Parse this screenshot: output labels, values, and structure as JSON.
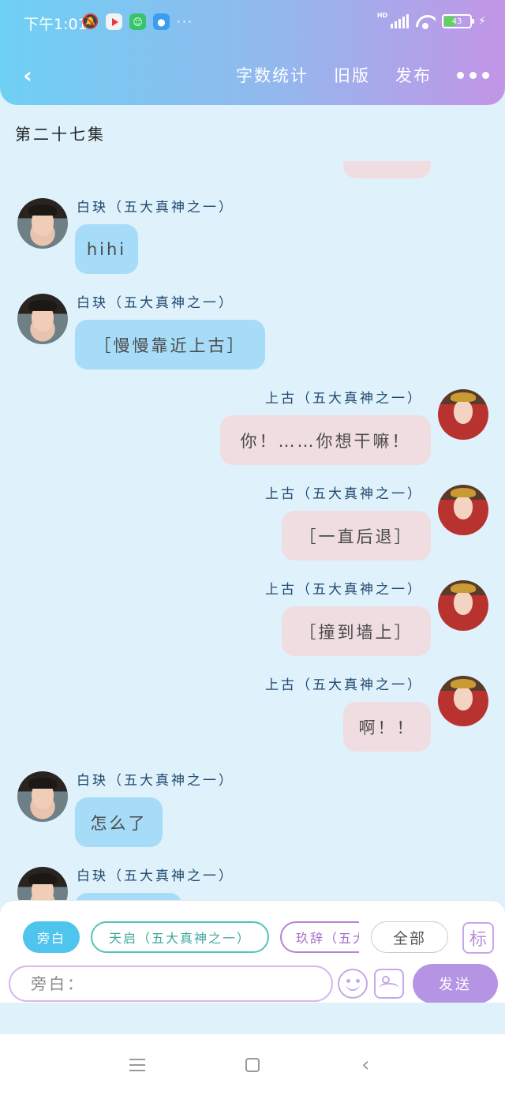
{
  "status_bar": {
    "time": "下午1:01",
    "more": "···",
    "hd": "HD",
    "battery": "43",
    "bolt": "⚡"
  },
  "nav": {
    "back_icon": "‹",
    "word_count": "字数统计",
    "old_version": "旧版",
    "publish": "发布"
  },
  "episode_title": "第二十七集",
  "messages": [
    {
      "side": "left",
      "avatar": "male",
      "sender": "白玦（五大真神之一）",
      "text": "hihi"
    },
    {
      "side": "left",
      "avatar": "male",
      "sender": "白玦（五大真神之一）",
      "text": "［慢慢靠近上古］"
    },
    {
      "side": "right",
      "avatar": "female",
      "sender": "上古（五大真神之一）",
      "text": "你！……你想干嘛！"
    },
    {
      "side": "right",
      "avatar": "female",
      "sender": "上古（五大真神之一）",
      "text": "［一直后退］"
    },
    {
      "side": "right",
      "avatar": "female",
      "sender": "上古（五大真神之一）",
      "text": "［撞到墙上］"
    },
    {
      "side": "right",
      "avatar": "female",
      "sender": "上古（五大真神之一）",
      "text": "啊！！"
    },
    {
      "side": "left",
      "avatar": "male",
      "sender": "白玦（五大真神之一）",
      "text": "怎么了"
    },
    {
      "side": "left",
      "avatar": "male",
      "sender": "白玦（五大真神之一）",
      "text": ""
    }
  ],
  "roles": {
    "narration": "旁白",
    "tianqi": "天启（五大真神之一）",
    "jiuci": "玖辞（五大真神之一）",
    "all": "全部",
    "tag": "标"
  },
  "input": {
    "placeholder": "旁白：",
    "send": "发送"
  }
}
